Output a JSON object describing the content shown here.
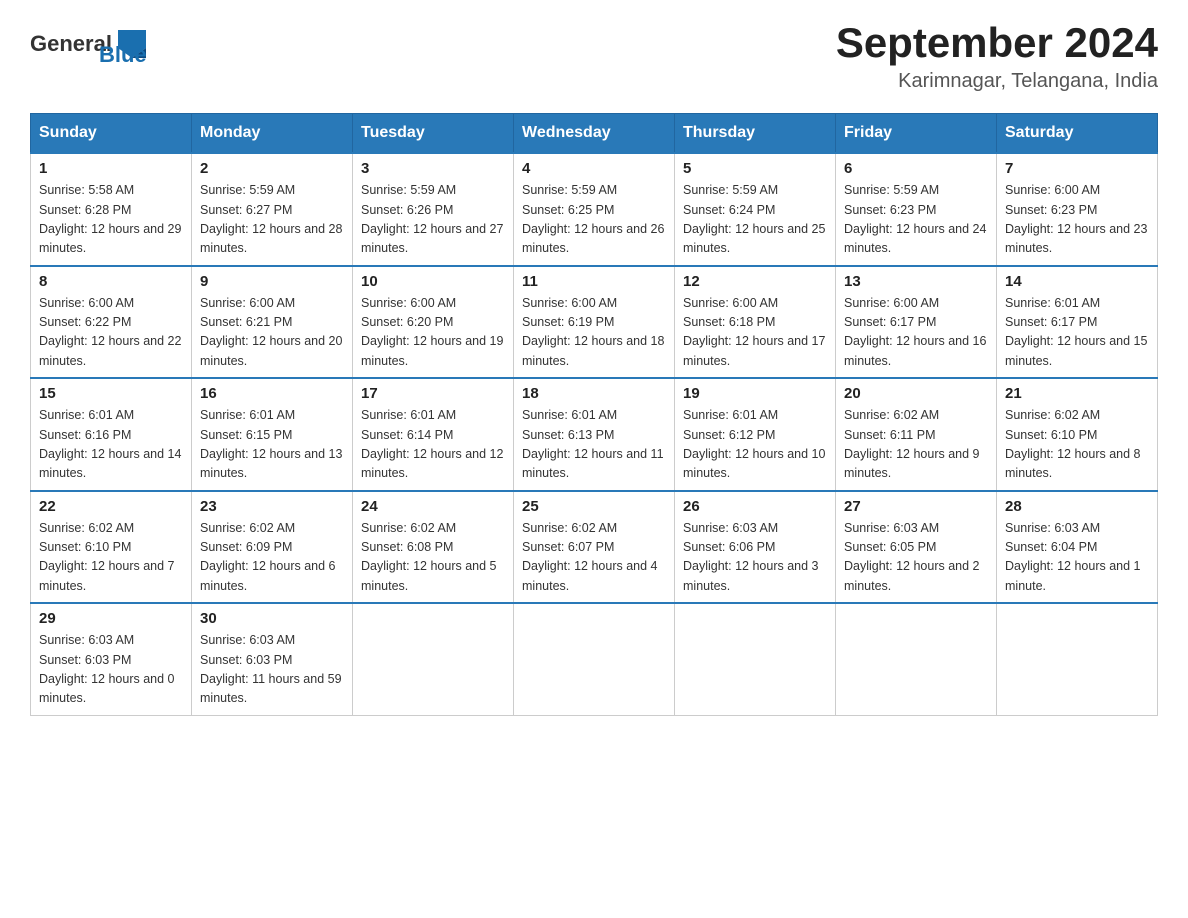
{
  "header": {
    "logo_general": "General",
    "logo_blue": "Blue",
    "month_year": "September 2024",
    "location": "Karimnagar, Telangana, India"
  },
  "days_of_week": [
    "Sunday",
    "Monday",
    "Tuesday",
    "Wednesday",
    "Thursday",
    "Friday",
    "Saturday"
  ],
  "weeks": [
    [
      {
        "day": "1",
        "sunrise": "5:58 AM",
        "sunset": "6:28 PM",
        "daylight": "12 hours and 29 minutes."
      },
      {
        "day": "2",
        "sunrise": "5:59 AM",
        "sunset": "6:27 PM",
        "daylight": "12 hours and 28 minutes."
      },
      {
        "day": "3",
        "sunrise": "5:59 AM",
        "sunset": "6:26 PM",
        "daylight": "12 hours and 27 minutes."
      },
      {
        "day": "4",
        "sunrise": "5:59 AM",
        "sunset": "6:25 PM",
        "daylight": "12 hours and 26 minutes."
      },
      {
        "day": "5",
        "sunrise": "5:59 AM",
        "sunset": "6:24 PM",
        "daylight": "12 hours and 25 minutes."
      },
      {
        "day": "6",
        "sunrise": "5:59 AM",
        "sunset": "6:23 PM",
        "daylight": "12 hours and 24 minutes."
      },
      {
        "day": "7",
        "sunrise": "6:00 AM",
        "sunset": "6:23 PM",
        "daylight": "12 hours and 23 minutes."
      }
    ],
    [
      {
        "day": "8",
        "sunrise": "6:00 AM",
        "sunset": "6:22 PM",
        "daylight": "12 hours and 22 minutes."
      },
      {
        "day": "9",
        "sunrise": "6:00 AM",
        "sunset": "6:21 PM",
        "daylight": "12 hours and 20 minutes."
      },
      {
        "day": "10",
        "sunrise": "6:00 AM",
        "sunset": "6:20 PM",
        "daylight": "12 hours and 19 minutes."
      },
      {
        "day": "11",
        "sunrise": "6:00 AM",
        "sunset": "6:19 PM",
        "daylight": "12 hours and 18 minutes."
      },
      {
        "day": "12",
        "sunrise": "6:00 AM",
        "sunset": "6:18 PM",
        "daylight": "12 hours and 17 minutes."
      },
      {
        "day": "13",
        "sunrise": "6:00 AM",
        "sunset": "6:17 PM",
        "daylight": "12 hours and 16 minutes."
      },
      {
        "day": "14",
        "sunrise": "6:01 AM",
        "sunset": "6:17 PM",
        "daylight": "12 hours and 15 minutes."
      }
    ],
    [
      {
        "day": "15",
        "sunrise": "6:01 AM",
        "sunset": "6:16 PM",
        "daylight": "12 hours and 14 minutes."
      },
      {
        "day": "16",
        "sunrise": "6:01 AM",
        "sunset": "6:15 PM",
        "daylight": "12 hours and 13 minutes."
      },
      {
        "day": "17",
        "sunrise": "6:01 AM",
        "sunset": "6:14 PM",
        "daylight": "12 hours and 12 minutes."
      },
      {
        "day": "18",
        "sunrise": "6:01 AM",
        "sunset": "6:13 PM",
        "daylight": "12 hours and 11 minutes."
      },
      {
        "day": "19",
        "sunrise": "6:01 AM",
        "sunset": "6:12 PM",
        "daylight": "12 hours and 10 minutes."
      },
      {
        "day": "20",
        "sunrise": "6:02 AM",
        "sunset": "6:11 PM",
        "daylight": "12 hours and 9 minutes."
      },
      {
        "day": "21",
        "sunrise": "6:02 AM",
        "sunset": "6:10 PM",
        "daylight": "12 hours and 8 minutes."
      }
    ],
    [
      {
        "day": "22",
        "sunrise": "6:02 AM",
        "sunset": "6:10 PM",
        "daylight": "12 hours and 7 minutes."
      },
      {
        "day": "23",
        "sunrise": "6:02 AM",
        "sunset": "6:09 PM",
        "daylight": "12 hours and 6 minutes."
      },
      {
        "day": "24",
        "sunrise": "6:02 AM",
        "sunset": "6:08 PM",
        "daylight": "12 hours and 5 minutes."
      },
      {
        "day": "25",
        "sunrise": "6:02 AM",
        "sunset": "6:07 PM",
        "daylight": "12 hours and 4 minutes."
      },
      {
        "day": "26",
        "sunrise": "6:03 AM",
        "sunset": "6:06 PM",
        "daylight": "12 hours and 3 minutes."
      },
      {
        "day": "27",
        "sunrise": "6:03 AM",
        "sunset": "6:05 PM",
        "daylight": "12 hours and 2 minutes."
      },
      {
        "day": "28",
        "sunrise": "6:03 AM",
        "sunset": "6:04 PM",
        "daylight": "12 hours and 1 minute."
      }
    ],
    [
      {
        "day": "29",
        "sunrise": "6:03 AM",
        "sunset": "6:03 PM",
        "daylight": "12 hours and 0 minutes."
      },
      {
        "day": "30",
        "sunrise": "6:03 AM",
        "sunset": "6:03 PM",
        "daylight": "11 hours and 59 minutes."
      },
      null,
      null,
      null,
      null,
      null
    ]
  ]
}
